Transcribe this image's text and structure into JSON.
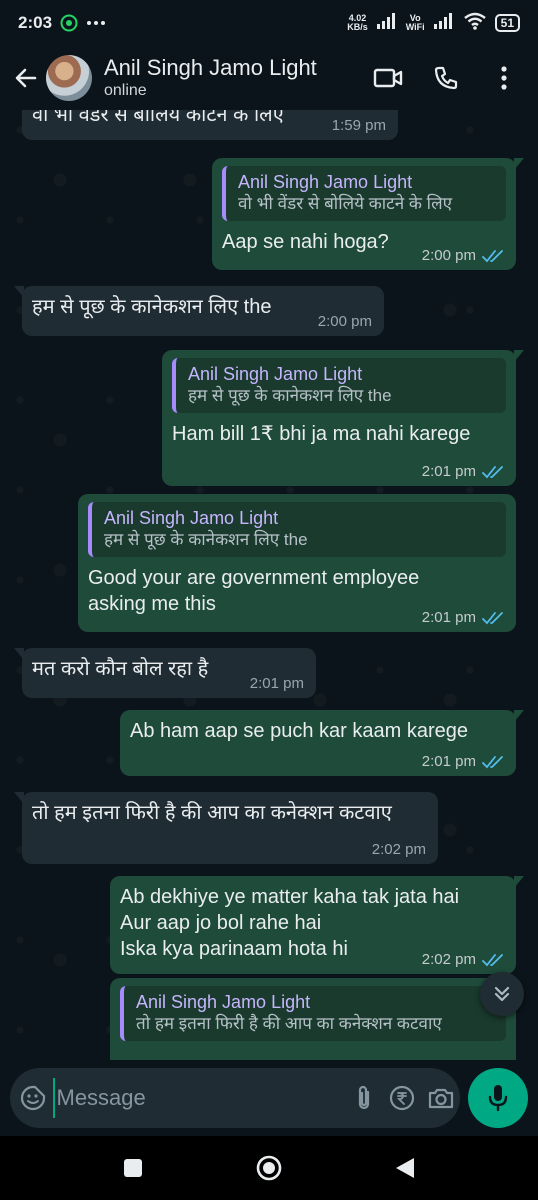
{
  "status_bar": {
    "time": "2:03",
    "speed_value": "4.02",
    "speed_unit": "KB/s",
    "vowifi_top": "Vo",
    "vowifi_bottom": "WiFi",
    "battery": "51"
  },
  "header": {
    "contact_name": "Anil Singh Jamo Light",
    "status": "online"
  },
  "messages": [
    {
      "dir": "in",
      "text": "वो भी वेंडर से बोलिये काटने के लिए",
      "time": "1:59 pm"
    },
    {
      "dir": "out",
      "quote_name": "Anil Singh Jamo Light",
      "quote_text": "वो भी वेंडर से बोलिये काटने के लिए",
      "text": "Aap se nahi hoga?",
      "time": "2:00 pm"
    },
    {
      "dir": "in",
      "text": "हम से पूछ के कानेकशन लिए the",
      "time": "2:00 pm"
    },
    {
      "dir": "out",
      "quote_name": "Anil Singh Jamo Light",
      "quote_text": "हम से पूछ के कानेकशन लिए the",
      "text": "Ham bill 1₹ bhi ja ma nahi karege",
      "time": "2:01 pm"
    },
    {
      "dir": "out",
      "quote_name": "Anil Singh Jamo Light",
      "quote_text": "हम से पूछ के कानेकशन लिए the",
      "text": "Good your are government employee\nasking me this",
      "time": "2:01 pm"
    },
    {
      "dir": "in",
      "text": "मत करो कौन बोल रहा है",
      "time": "2:01 pm"
    },
    {
      "dir": "out",
      "text": "Ab ham aap se puch kar kaam karege",
      "time": "2:01 pm"
    },
    {
      "dir": "in",
      "text": "तो हम इतना फिरी है की आप का कनेक्शन कटवाए",
      "time": "2:02 pm"
    },
    {
      "dir": "out",
      "text": "Ab dekhiye ye matter kaha tak jata hai\nAur aap jo bol rahe hai\nIska kya parinaam hota hi",
      "time": "2:02 pm"
    },
    {
      "dir": "out",
      "quote_name": "Anil Singh Jamo Light",
      "quote_text": "तो हम इतना फिरी है की आप का कनेक्शन कटवाए",
      "text": "",
      "time": ""
    }
  ],
  "composer": {
    "placeholder": "Message"
  },
  "colors": {
    "background": "#0b141a",
    "incoming_bubble": "#202c33",
    "outgoing_bubble": "#1f4b3a",
    "accent": "#00a884",
    "quote_bar": "#a78bfa",
    "read_ticks": "#53bdeb"
  },
  "icons": {
    "back": "arrow-left-icon",
    "video": "video-call-icon",
    "call": "phone-icon",
    "menu": "more-vert-icon",
    "emoji": "sticker-icon",
    "attach": "paperclip-icon",
    "payment": "rupee-icon",
    "camera": "camera-icon",
    "mic": "mic-icon",
    "scroll": "double-chevron-down-icon"
  }
}
